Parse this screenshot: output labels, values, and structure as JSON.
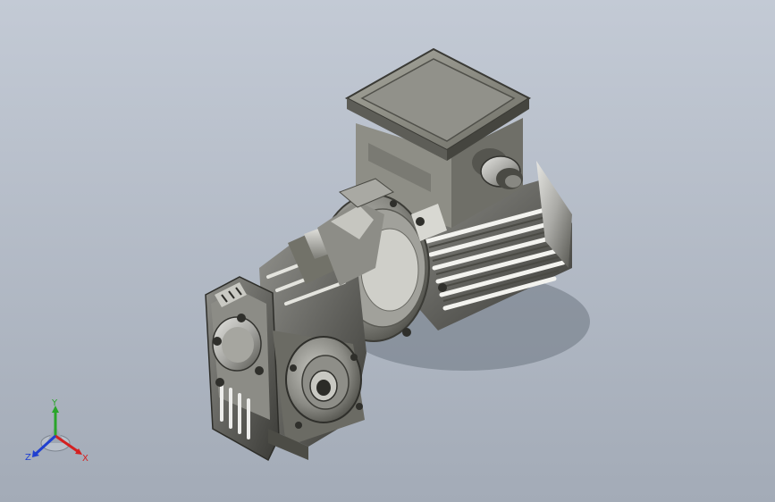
{
  "viewport": {
    "background_top": "#c3cad5",
    "background_bottom": "#a3abb7",
    "model": "worm-gear-motor"
  },
  "triad": {
    "x_label": "X",
    "y_label": "Y",
    "z_label": "Z",
    "x_color": "#d42020",
    "y_color": "#2aa52a",
    "z_color": "#2040d0"
  }
}
